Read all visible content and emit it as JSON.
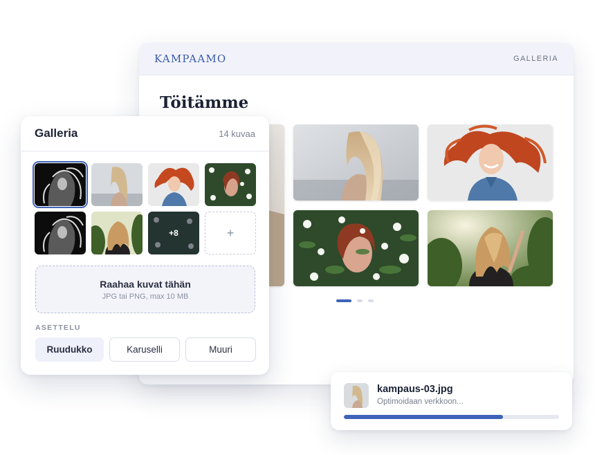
{
  "website": {
    "brand": "KAMPAAMO",
    "nav_item": "GALLERIA",
    "heading": "Töitämme",
    "carousel_dots": 3,
    "active_dot": 0
  },
  "gallery_panel": {
    "title": "Galleria",
    "count_label": "14 kuvaa",
    "more_label": "+8",
    "add_label": "+",
    "dropzone": {
      "title": "Raahaa kuvat tähän",
      "subtitle": "JPG tai PNG, max 10 MB"
    },
    "layout_label": "ASETTELU",
    "layout_options": [
      "Ruudukko",
      "Karuselli",
      "Muuri"
    ],
    "selected_layout": "Ruudukko"
  },
  "upload_toast": {
    "filename": "kampaus-03.jpg",
    "status": "Optimoidaan verkkoon...",
    "progress": 0.74
  },
  "colors": {
    "accent": "#3e63b8",
    "brand": "#3a5aa8"
  }
}
